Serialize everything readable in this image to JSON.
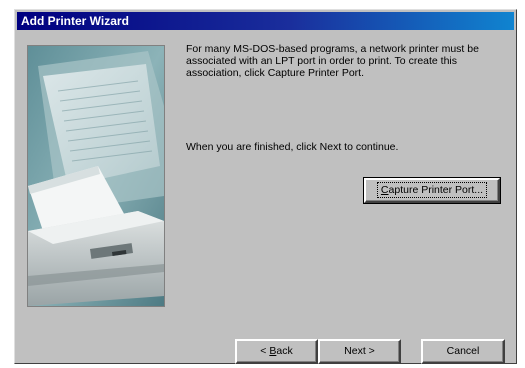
{
  "window": {
    "title": "Add Printer Wizard"
  },
  "content": {
    "description": "For many MS-DOS-based programs, a network printer must be associated with an LPT port in order to print. To create this association, click Capture Printer Port.",
    "finish_instruction": "When you are finished, click Next to continue."
  },
  "buttons": {
    "capture_mnemonic": "C",
    "capture_rest": "apture Printer Port...",
    "back_prefix": "< ",
    "back_mnemonic": "B",
    "back_rest": "ack",
    "next": "Next >",
    "cancel": "Cancel"
  },
  "colors": {
    "titlebar_start": "#000080",
    "titlebar_end": "#1084d0",
    "face": "#c0c0c0"
  }
}
